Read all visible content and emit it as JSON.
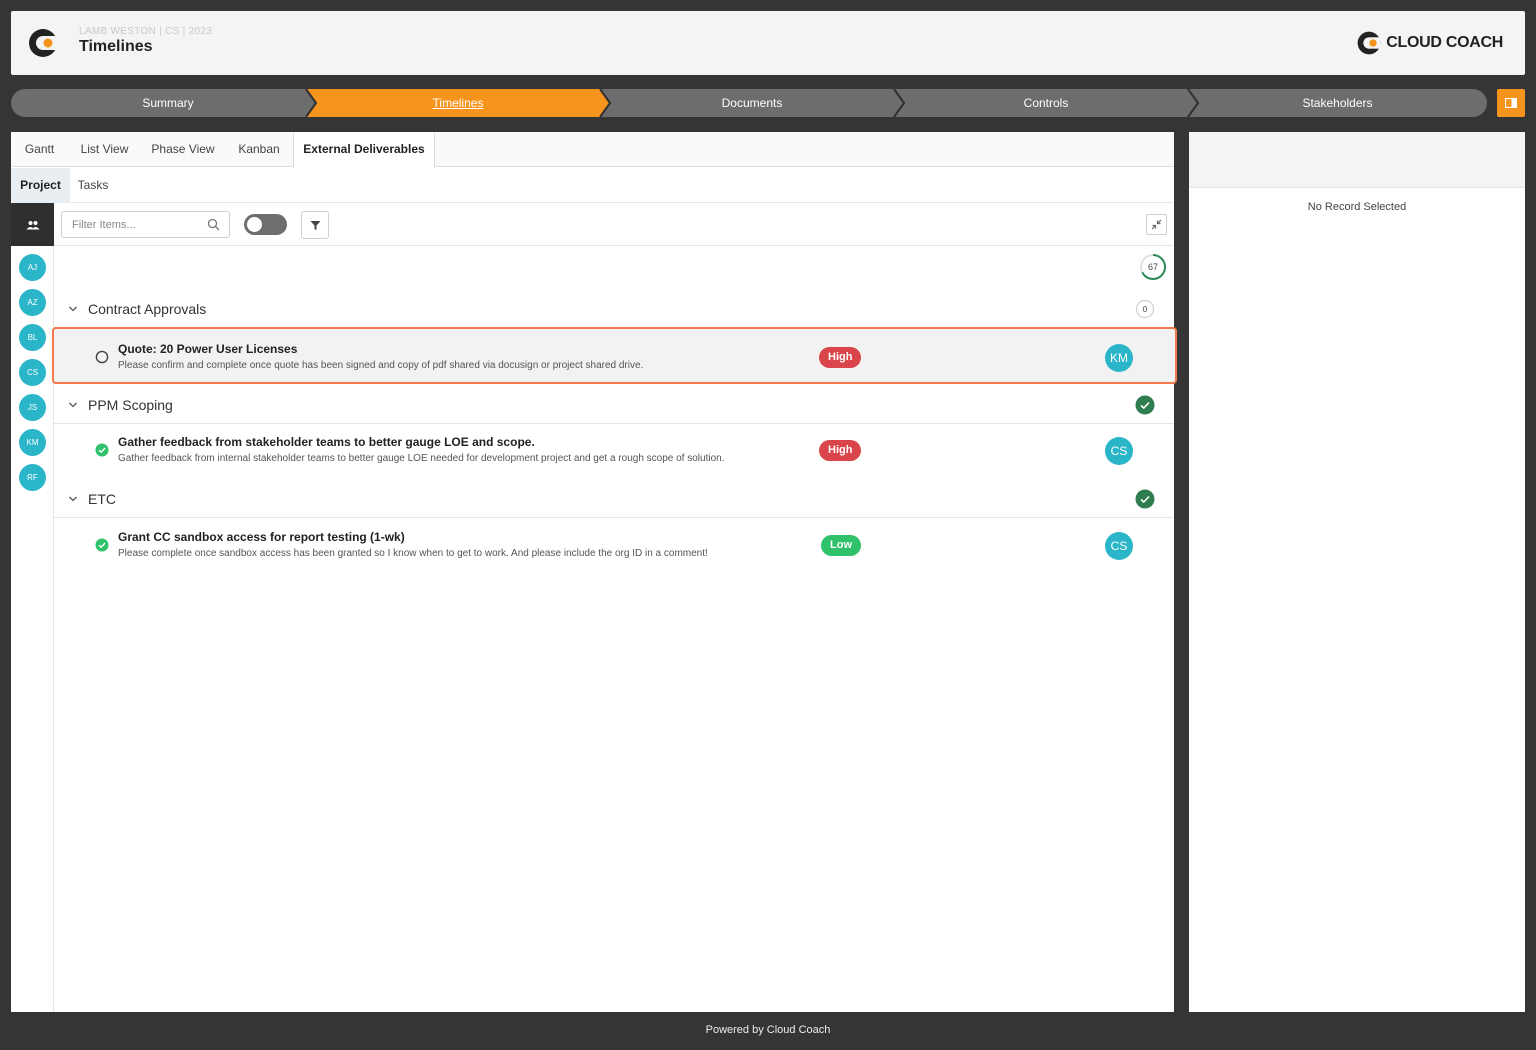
{
  "header": {
    "subtitle": "LAMB WESTON | CS | 2023",
    "title": "Timelines",
    "brand": "CLOUD COACH",
    "accent": "#f7941d"
  },
  "stepper": {
    "steps": [
      "Summary",
      "Timelines",
      "Documents",
      "Controls",
      "Stakeholders"
    ],
    "active": "Timelines",
    "active_color": "#f7941d",
    "inactive_color": "#6d6d6d"
  },
  "view_tabs": [
    "Gantt",
    "List View",
    "Phase View",
    "Kanban",
    "External Deliverables"
  ],
  "sub_tabs": [
    "Project",
    "Tasks"
  ],
  "toolbar": {
    "filter_placeholder": "Filter Items...",
    "icons": [
      "people-icon",
      "search-icon",
      "filter-icon",
      "collapse-icon"
    ]
  },
  "people": [
    "AJ",
    "AZ",
    "BL",
    "CS",
    "JS",
    "KM",
    "RF"
  ],
  "progress": {
    "value": 67
  },
  "groups": [
    {
      "title": "Contract Approvals",
      "status": "0",
      "complete": false,
      "tasks": [
        {
          "title": "Quote: 20 Power User Licenses",
          "description": "Please confirm and complete once quote has been signed and copy of pdf shared via docusign or project shared drive.",
          "priority": "High",
          "assignee": "KM",
          "done": false
        }
      ]
    },
    {
      "title": "PPM Scoping",
      "status": "",
      "complete": true,
      "tasks": [
        {
          "title": "Gather feedback from stakeholder teams to better gauge LOE and scope.",
          "description": "Gather feedback from internal stakeholder teams to better gauge LOE needed for development project and get a rough scope of solution.",
          "priority": "High",
          "assignee": "CS",
          "done": true
        }
      ]
    },
    {
      "title": "ETC",
      "status": "",
      "complete": true,
      "tasks": [
        {
          "title": "Grant CC sandbox access for report testing (1-wk)",
          "description": "Please complete once sandbox access has been granted so I know when to get to work. And please include the org ID in a comment!",
          "priority": "Low",
          "assignee": "CS",
          "done": true
        }
      ]
    }
  ],
  "side_panel": {
    "empty_text": "No Record Selected"
  },
  "footer": "Powered by Cloud Coach"
}
